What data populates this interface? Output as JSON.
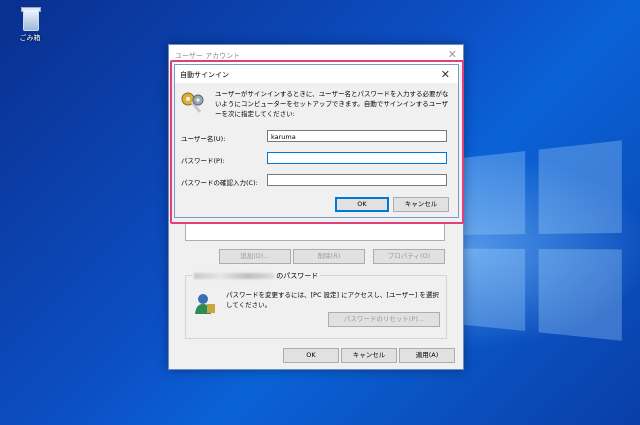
{
  "desktop": {
    "recycle_bin_label": "ごみ箱"
  },
  "outer_dialog": {
    "title": "ユーザー アカウント",
    "buttons": {
      "add": "追加(D)...",
      "remove": "削除(R)",
      "properties": "プロパティ(O)"
    },
    "password_group_label": "のパスワード",
    "password_description": "パスワードを変更するには、[PC 設定] にアクセスし、[ユーザー] を選択してください。",
    "reset_password_button": "パスワードのリセット(P)...",
    "ok": "OK",
    "cancel": "キャンセル",
    "apply": "適用(A)"
  },
  "auto_signin_dialog": {
    "title": "自動サインイン",
    "description": "ユーザーがサインインするときに、ユーザー名とパスワードを入力する必要がないようにコンピューターをセットアップできます。自動でサインインするユーザーを次に指定してください:",
    "username_label": "ユーザー名(U):",
    "username_value": "karuma",
    "password_label": "パスワード(P):",
    "password_value": "",
    "confirm_label": "パスワードの確認入力(C):",
    "confirm_value": "",
    "ok": "OK",
    "cancel": "キャンセル"
  },
  "icons": [
    "recycle-bin-icon",
    "keys-icon",
    "user-icon",
    "close-icon"
  ],
  "colors": {
    "highlight_frame": "#e0407a",
    "focus_border": "#0078d7",
    "desktop_blue": "#0c4fc4"
  }
}
